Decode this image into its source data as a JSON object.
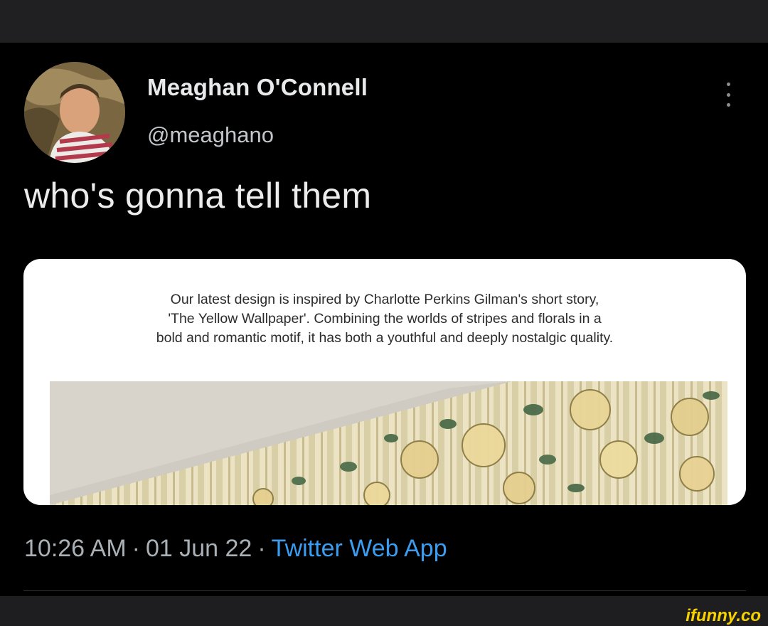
{
  "author": {
    "name": "Meaghan O'Connell",
    "handle": "@meaghano"
  },
  "tweet": {
    "text": "who's gonna tell them",
    "card_caption_lines": [
      "Our latest design is inspired by Charlotte Perkins Gilman's short story,",
      "'The Yellow Wallpaper'. Combining the worlds of stripes and florals in a",
      "bold and romantic motif, it has both a youthful and deeply nostalgic quality."
    ]
  },
  "meta": {
    "time": "10:26 AM",
    "separator": "·",
    "date": "01 Jun 22",
    "source": "Twitter Web App"
  },
  "watermark": "ifunny.co",
  "icons": {
    "more": "more-options-icon",
    "avatar": "avatar"
  },
  "colors": {
    "background": "#000000",
    "link": "#3b9df0",
    "text": "#e7e9ea",
    "muted": "#a9b0b6",
    "watermark": "#f6d000"
  }
}
